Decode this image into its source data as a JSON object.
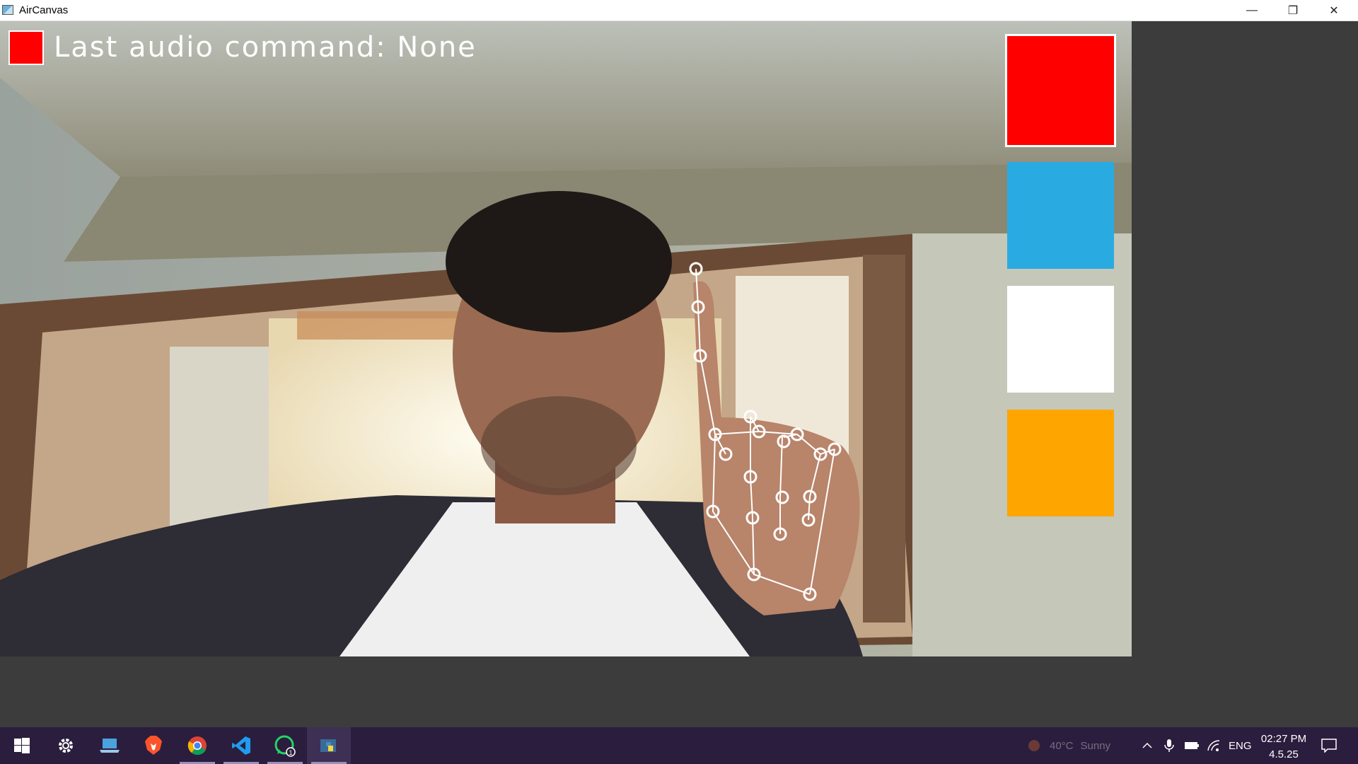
{
  "window": {
    "title": "AirCanvas",
    "minimize_glyph": "—",
    "restore_glyph": "❐",
    "close_glyph": "✕"
  },
  "overlay": {
    "current_color": "#ff0000",
    "audio_command_text": "Last audio command: None"
  },
  "palette": [
    {
      "name": "red",
      "color": "#ff0000",
      "selected": true
    },
    {
      "name": "blue",
      "color": "#29abe2",
      "selected": false
    },
    {
      "name": "white",
      "color": "#ffffff",
      "selected": false
    },
    {
      "name": "orange",
      "color": "#ffa500",
      "selected": false
    }
  ],
  "taskbar": {
    "items": [
      {
        "name": "start-button",
        "icon": "windows-logo-icon"
      },
      {
        "name": "settings-button",
        "icon": "gear-icon"
      },
      {
        "name": "this-pc-button",
        "icon": "laptop-icon"
      },
      {
        "name": "brave-button",
        "icon": "brave-lion-icon"
      },
      {
        "name": "chrome-button",
        "icon": "chrome-icon"
      },
      {
        "name": "vscode-button",
        "icon": "vscode-icon"
      },
      {
        "name": "whatsapp-button",
        "icon": "whatsapp-icon",
        "badge": "1"
      },
      {
        "name": "python-button",
        "icon": "python-icon"
      }
    ],
    "weather": {
      "temp": "40°C",
      "condition": "Sunny"
    },
    "language": "ENG",
    "time": "02:27 PM",
    "date": "4.5.25"
  }
}
